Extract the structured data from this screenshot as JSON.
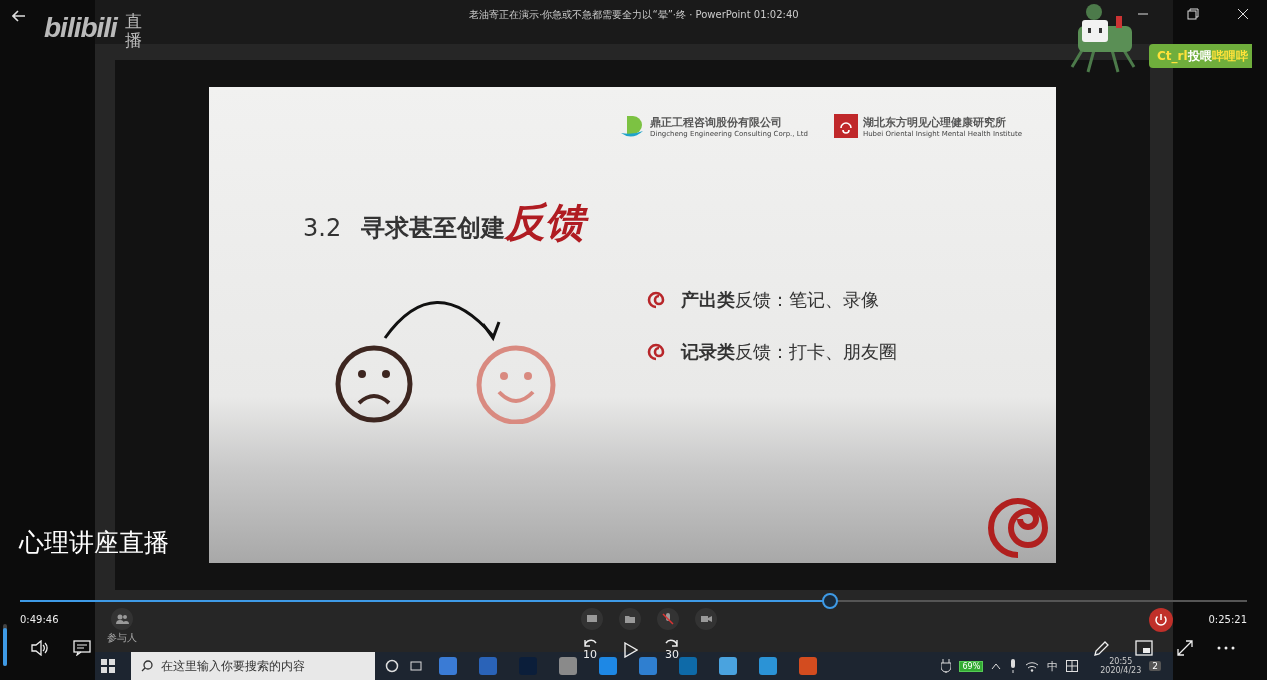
{
  "window": {
    "title": "老油寄正在演示·你急或不急都需要全力以“晕”·终 · PowerPoint 01:02:40"
  },
  "brand": {
    "logo": "bilibili",
    "section": "直播"
  },
  "gift_banner": {
    "parts": [
      {
        "text": "Ct_rl",
        "kind": "accent"
      },
      {
        "text": "投喂",
        "kind": "plain"
      },
      {
        "text": "哔哩哔",
        "kind": "accent"
      }
    ]
  },
  "slide": {
    "logos": [
      {
        "name": "鼎正工程咨询股份有限公司",
        "subtitle": "Dingcheng Engineering Consulting Corp., Ltd",
        "kind": "wave"
      },
      {
        "name": "湖北东方明见心理健康研究所",
        "subtitle": "Hubei Oriental Insight Mental Health Institute",
        "kind": "seal"
      }
    ],
    "number": "3.2",
    "heading": "寻求甚至创建",
    "heading_accent": "反馈",
    "bullets": [
      "**产出类**反馈：笔记、录像",
      "**记录类**反馈：打卡、朋友圈"
    ]
  },
  "meeting_toolbar": {
    "participants_label": "参与人"
  },
  "live_title": "心理讲座直播",
  "player": {
    "current_time": "0:49:46",
    "duration": "0:25:21",
    "progress": {
      "level": 0.66
    },
    "volume": {
      "level": 0.9
    },
    "rewind": "10",
    "forward": "30"
  },
  "taskbar": {
    "search_placeholder": "在这里输入你要搜索的内容",
    "battery": "69%",
    "ime": "中",
    "time": "20:55",
    "date": "2020/4/23",
    "notifications": "2"
  }
}
